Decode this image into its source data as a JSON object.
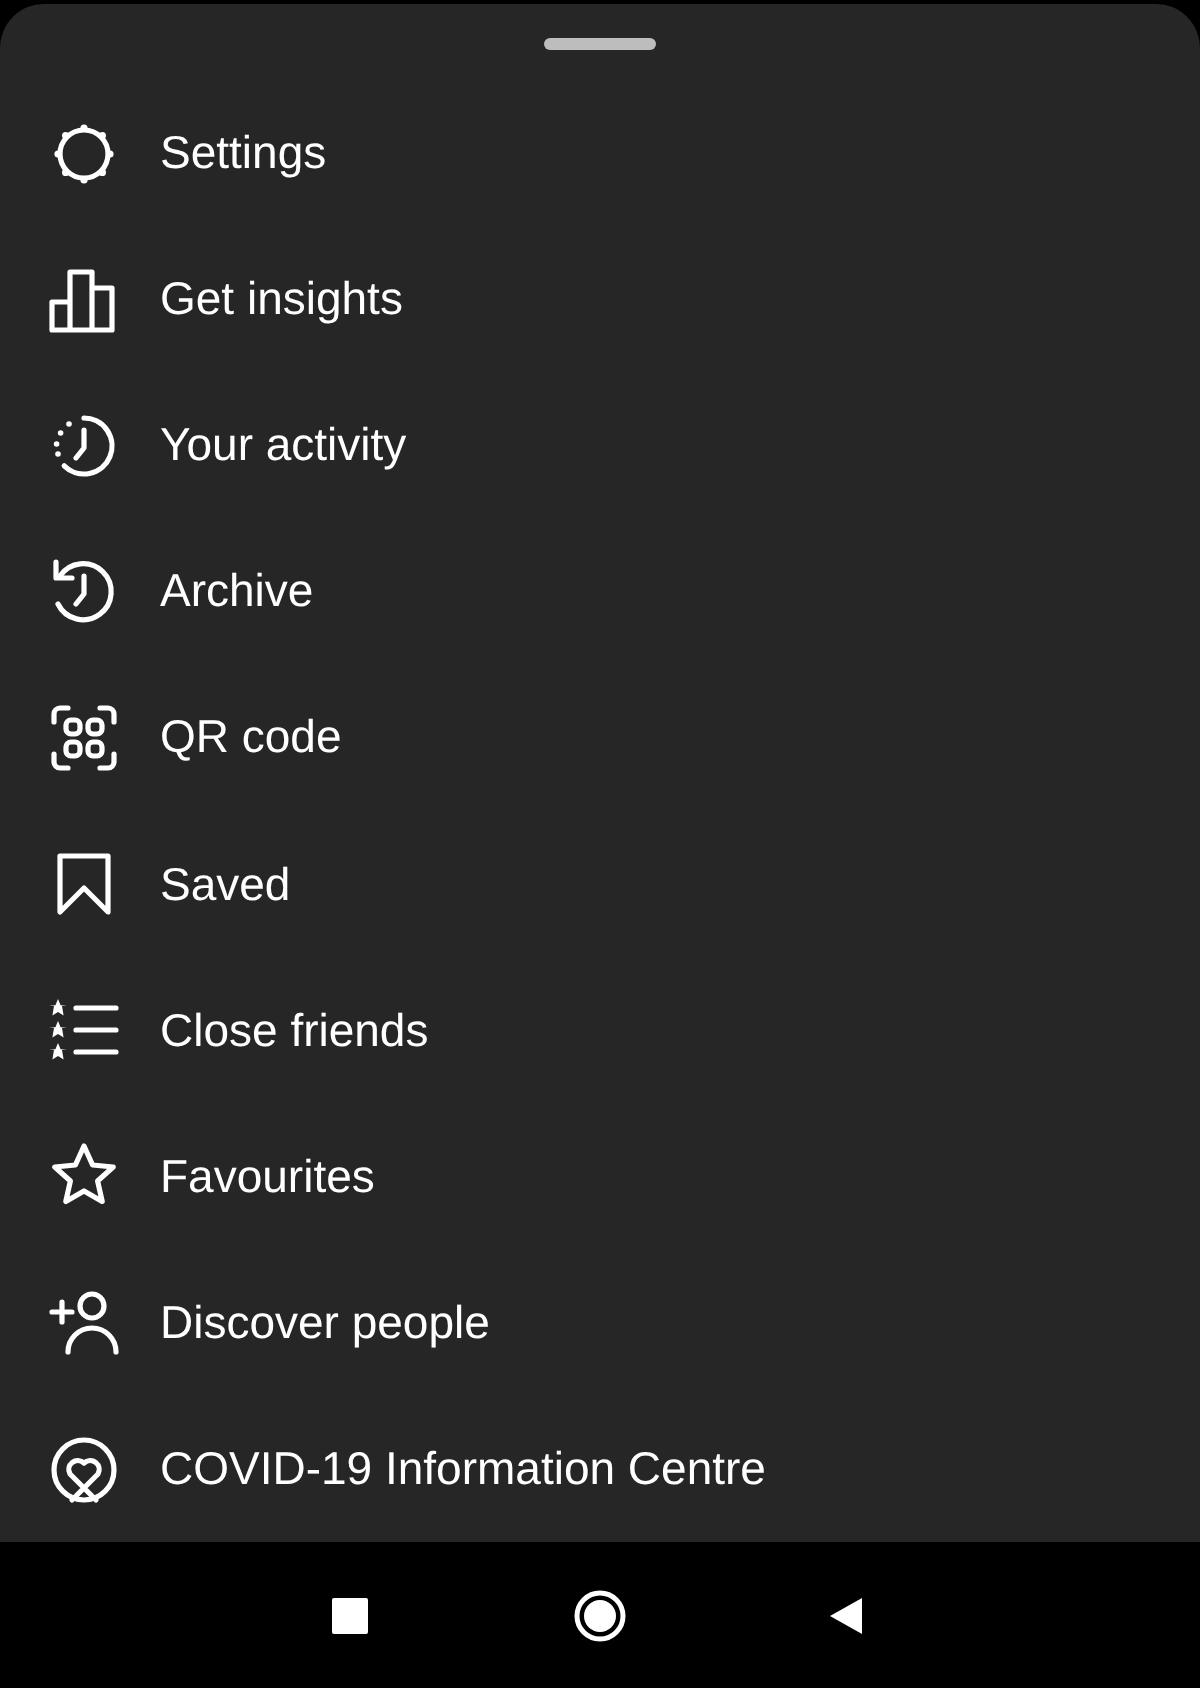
{
  "menu": [
    {
      "kind": "settings",
      "label": "Settings"
    },
    {
      "kind": "insights",
      "label": "Get insights"
    },
    {
      "kind": "activity",
      "label": "Your activity"
    },
    {
      "kind": "archive",
      "label": "Archive"
    },
    {
      "kind": "qr",
      "label": "QR code"
    },
    {
      "kind": "saved",
      "label": "Saved"
    },
    {
      "kind": "friends",
      "label": "Close friends"
    },
    {
      "kind": "favourites",
      "label": "Favourites"
    },
    {
      "kind": "discover",
      "label": "Discover people"
    },
    {
      "kind": "covid",
      "label": "COVID-19 Information Centre"
    }
  ]
}
